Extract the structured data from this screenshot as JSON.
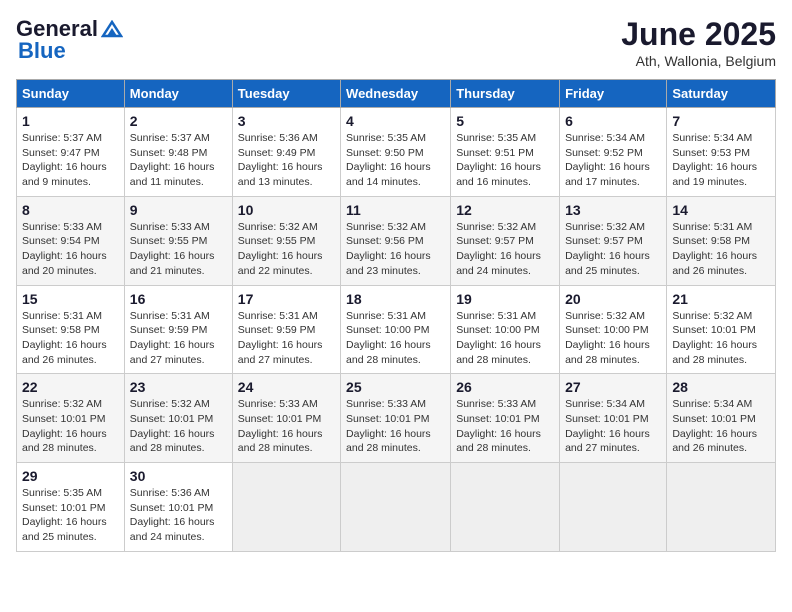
{
  "header": {
    "logo_general": "General",
    "logo_blue": "Blue",
    "month_title": "June 2025",
    "location": "Ath, Wallonia, Belgium"
  },
  "weekdays": [
    "Sunday",
    "Monday",
    "Tuesday",
    "Wednesday",
    "Thursday",
    "Friday",
    "Saturday"
  ],
  "weeks": [
    [
      {
        "day": "1",
        "sunrise": "Sunrise: 5:37 AM",
        "sunset": "Sunset: 9:47 PM",
        "daylight": "Daylight: 16 hours and 9 minutes."
      },
      {
        "day": "2",
        "sunrise": "Sunrise: 5:37 AM",
        "sunset": "Sunset: 9:48 PM",
        "daylight": "Daylight: 16 hours and 11 minutes."
      },
      {
        "day": "3",
        "sunrise": "Sunrise: 5:36 AM",
        "sunset": "Sunset: 9:49 PM",
        "daylight": "Daylight: 16 hours and 13 minutes."
      },
      {
        "day": "4",
        "sunrise": "Sunrise: 5:35 AM",
        "sunset": "Sunset: 9:50 PM",
        "daylight": "Daylight: 16 hours and 14 minutes."
      },
      {
        "day": "5",
        "sunrise": "Sunrise: 5:35 AM",
        "sunset": "Sunset: 9:51 PM",
        "daylight": "Daylight: 16 hours and 16 minutes."
      },
      {
        "day": "6",
        "sunrise": "Sunrise: 5:34 AM",
        "sunset": "Sunset: 9:52 PM",
        "daylight": "Daylight: 16 hours and 17 minutes."
      },
      {
        "day": "7",
        "sunrise": "Sunrise: 5:34 AM",
        "sunset": "Sunset: 9:53 PM",
        "daylight": "Daylight: 16 hours and 19 minutes."
      }
    ],
    [
      {
        "day": "8",
        "sunrise": "Sunrise: 5:33 AM",
        "sunset": "Sunset: 9:54 PM",
        "daylight": "Daylight: 16 hours and 20 minutes."
      },
      {
        "day": "9",
        "sunrise": "Sunrise: 5:33 AM",
        "sunset": "Sunset: 9:55 PM",
        "daylight": "Daylight: 16 hours and 21 minutes."
      },
      {
        "day": "10",
        "sunrise": "Sunrise: 5:32 AM",
        "sunset": "Sunset: 9:55 PM",
        "daylight": "Daylight: 16 hours and 22 minutes."
      },
      {
        "day": "11",
        "sunrise": "Sunrise: 5:32 AM",
        "sunset": "Sunset: 9:56 PM",
        "daylight": "Daylight: 16 hours and 23 minutes."
      },
      {
        "day": "12",
        "sunrise": "Sunrise: 5:32 AM",
        "sunset": "Sunset: 9:57 PM",
        "daylight": "Daylight: 16 hours and 24 minutes."
      },
      {
        "day": "13",
        "sunrise": "Sunrise: 5:32 AM",
        "sunset": "Sunset: 9:57 PM",
        "daylight": "Daylight: 16 hours and 25 minutes."
      },
      {
        "day": "14",
        "sunrise": "Sunrise: 5:31 AM",
        "sunset": "Sunset: 9:58 PM",
        "daylight": "Daylight: 16 hours and 26 minutes."
      }
    ],
    [
      {
        "day": "15",
        "sunrise": "Sunrise: 5:31 AM",
        "sunset": "Sunset: 9:58 PM",
        "daylight": "Daylight: 16 hours and 26 minutes."
      },
      {
        "day": "16",
        "sunrise": "Sunrise: 5:31 AM",
        "sunset": "Sunset: 9:59 PM",
        "daylight": "Daylight: 16 hours and 27 minutes."
      },
      {
        "day": "17",
        "sunrise": "Sunrise: 5:31 AM",
        "sunset": "Sunset: 9:59 PM",
        "daylight": "Daylight: 16 hours and 27 minutes."
      },
      {
        "day": "18",
        "sunrise": "Sunrise: 5:31 AM",
        "sunset": "Sunset: 10:00 PM",
        "daylight": "Daylight: 16 hours and 28 minutes."
      },
      {
        "day": "19",
        "sunrise": "Sunrise: 5:31 AM",
        "sunset": "Sunset: 10:00 PM",
        "daylight": "Daylight: 16 hours and 28 minutes."
      },
      {
        "day": "20",
        "sunrise": "Sunrise: 5:32 AM",
        "sunset": "Sunset: 10:00 PM",
        "daylight": "Daylight: 16 hours and 28 minutes."
      },
      {
        "day": "21",
        "sunrise": "Sunrise: 5:32 AM",
        "sunset": "Sunset: 10:01 PM",
        "daylight": "Daylight: 16 hours and 28 minutes."
      }
    ],
    [
      {
        "day": "22",
        "sunrise": "Sunrise: 5:32 AM",
        "sunset": "Sunset: 10:01 PM",
        "daylight": "Daylight: 16 hours and 28 minutes."
      },
      {
        "day": "23",
        "sunrise": "Sunrise: 5:32 AM",
        "sunset": "Sunset: 10:01 PM",
        "daylight": "Daylight: 16 hours and 28 minutes."
      },
      {
        "day": "24",
        "sunrise": "Sunrise: 5:33 AM",
        "sunset": "Sunset: 10:01 PM",
        "daylight": "Daylight: 16 hours and 28 minutes."
      },
      {
        "day": "25",
        "sunrise": "Sunrise: 5:33 AM",
        "sunset": "Sunset: 10:01 PM",
        "daylight": "Daylight: 16 hours and 28 minutes."
      },
      {
        "day": "26",
        "sunrise": "Sunrise: 5:33 AM",
        "sunset": "Sunset: 10:01 PM",
        "daylight": "Daylight: 16 hours and 28 minutes."
      },
      {
        "day": "27",
        "sunrise": "Sunrise: 5:34 AM",
        "sunset": "Sunset: 10:01 PM",
        "daylight": "Daylight: 16 hours and 27 minutes."
      },
      {
        "day": "28",
        "sunrise": "Sunrise: 5:34 AM",
        "sunset": "Sunset: 10:01 PM",
        "daylight": "Daylight: 16 hours and 26 minutes."
      }
    ],
    [
      {
        "day": "29",
        "sunrise": "Sunrise: 5:35 AM",
        "sunset": "Sunset: 10:01 PM",
        "daylight": "Daylight: 16 hours and 25 minutes."
      },
      {
        "day": "30",
        "sunrise": "Sunrise: 5:36 AM",
        "sunset": "Sunset: 10:01 PM",
        "daylight": "Daylight: 16 hours and 24 minutes."
      },
      null,
      null,
      null,
      null,
      null
    ]
  ]
}
